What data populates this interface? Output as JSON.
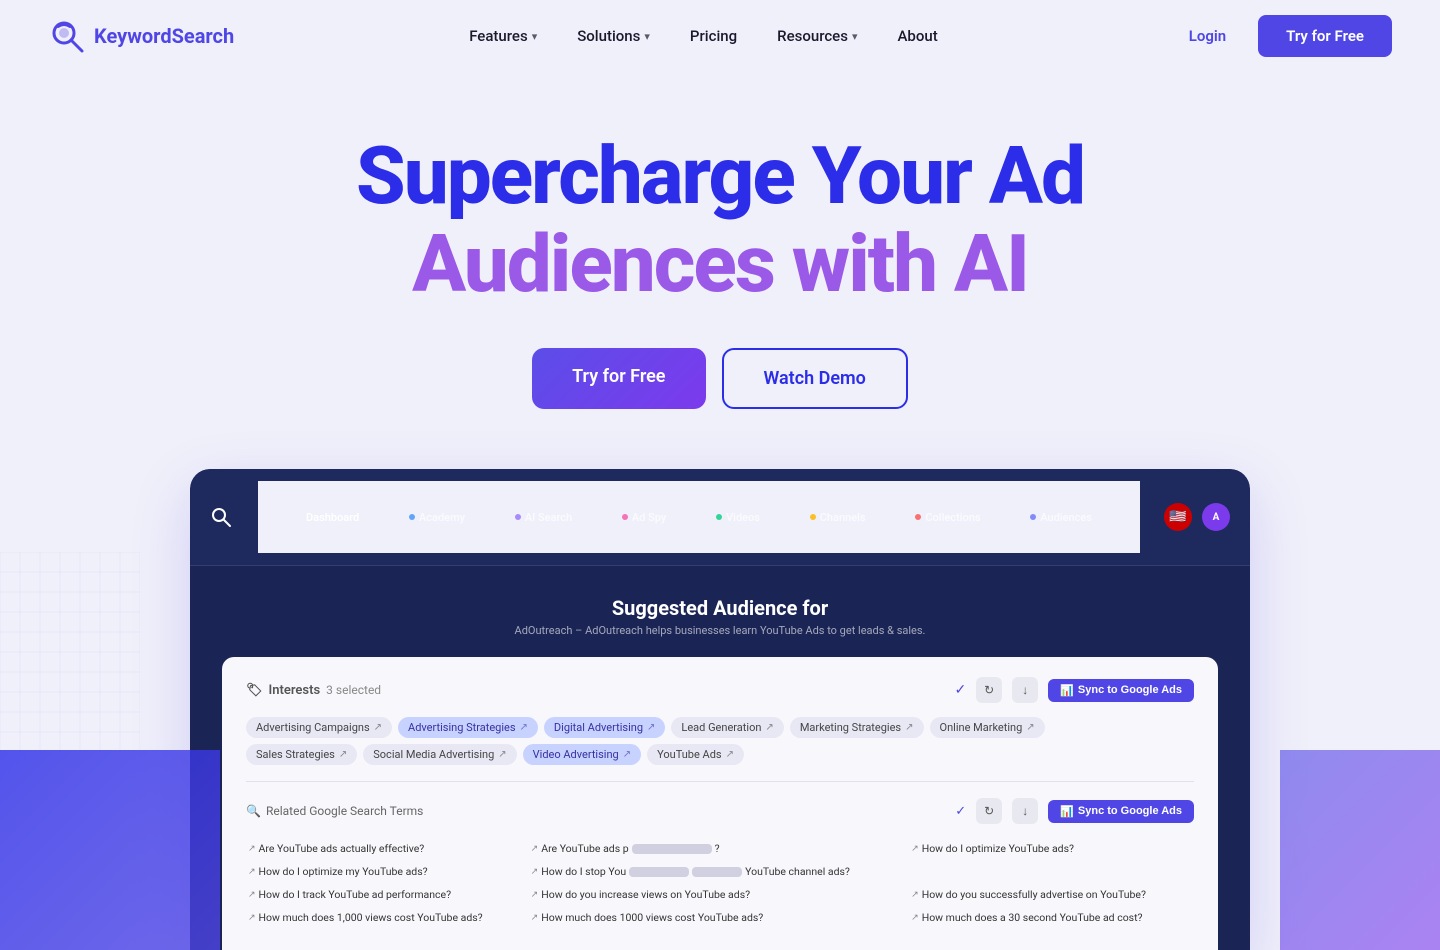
{
  "brand": {
    "logo_text_plain": "Keyword",
    "logo_text_accent": "Search",
    "logo_icon": "🎯"
  },
  "nav": {
    "items": [
      {
        "label": "Features",
        "has_dropdown": true
      },
      {
        "label": "Solutions",
        "has_dropdown": true
      },
      {
        "label": "Pricing",
        "has_dropdown": false
      },
      {
        "label": "Resources",
        "has_dropdown": true
      },
      {
        "label": "About",
        "has_dropdown": false
      }
    ],
    "login_label": "Login",
    "try_label": "Try for Free"
  },
  "hero": {
    "headline_part1": "Supercharge Your Ad",
    "headline_part2": "Audiences with AI",
    "cta_primary": "Try for Free",
    "cta_secondary": "Watch Demo"
  },
  "screen": {
    "nav_items": [
      {
        "label": "Dashboard",
        "dot": false
      },
      {
        "label": "Academy",
        "dot": true
      },
      {
        "label": "AI Search",
        "dot": true
      },
      {
        "label": "Ad Spy",
        "dot": true
      },
      {
        "label": "Videos",
        "dot": true
      },
      {
        "label": "Channels",
        "dot": true
      },
      {
        "label": "Collections",
        "dot": true
      },
      {
        "label": "Audiences",
        "dot": true
      }
    ],
    "section_title": "Suggested Audience for",
    "section_subtitle": "AdOutreach – AdOutreach helps businesses learn YouTube Ads to get leads & sales.",
    "interests_label": "Interests",
    "interests_count": "3 selected",
    "sync_btn": "Sync to Google Ads",
    "tags": [
      {
        "text": "Advertising Campaigns",
        "highlighted": false
      },
      {
        "text": "Advertising Strategies",
        "highlighted": true
      },
      {
        "text": "Digital Advertising",
        "highlighted": true
      },
      {
        "text": "Lead Generation",
        "highlighted": false
      },
      {
        "text": "Marketing Strategies",
        "highlighted": false
      },
      {
        "text": "Online Marketing",
        "highlighted": false
      },
      {
        "text": "Sales Strategies",
        "highlighted": false
      },
      {
        "text": "Social Media Advertising",
        "highlighted": false
      },
      {
        "text": "Video Advertising",
        "highlighted": true
      },
      {
        "text": "YouTube Ads",
        "highlighted": false
      }
    ],
    "related_label": "Related Google Search Terms",
    "search_terms": [
      "Are YouTube ads actually effective?",
      "Are YouTube ads p[...]",
      "How do I optimize YouTube ads?",
      "How do I optimize my YouTube ads?",
      "How do I stop You[...]",
      "YouTube channel ads?",
      "How do I track YouTube ad performance?",
      "How do you increase views on YouTube ads?",
      "How do you successfully advertise on YouTube?",
      "How much does 1,000 views cost YouTube ads?",
      "How much does 1000 views cost YouTube ads?",
      "How much does a 30 second YouTube ad cost?"
    ]
  }
}
